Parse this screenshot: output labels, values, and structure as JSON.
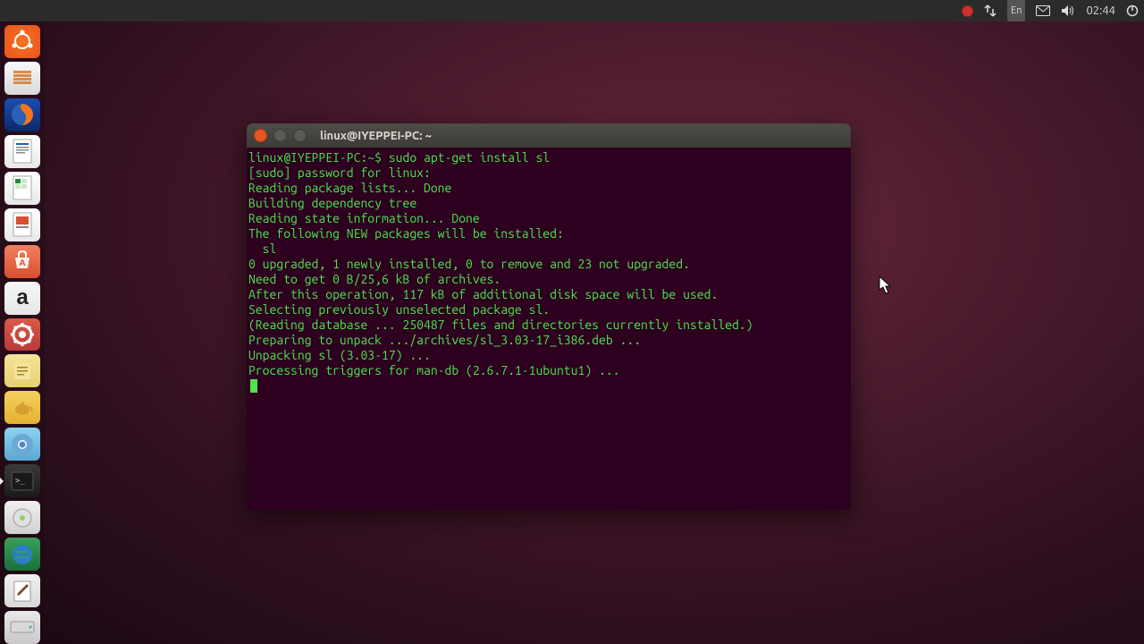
{
  "panel": {
    "language": "En",
    "clock": "02:44"
  },
  "launcher": {
    "items": [
      {
        "name": "dash",
        "label": "Ubuntu Dash"
      },
      {
        "name": "files",
        "label": "Files"
      },
      {
        "name": "firefox",
        "label": "Firefox"
      },
      {
        "name": "writer",
        "label": "LibreOffice Writer"
      },
      {
        "name": "calc",
        "label": "LibreOffice Calc"
      },
      {
        "name": "impress",
        "label": "LibreOffice Impress"
      },
      {
        "name": "software-center",
        "label": "Ubuntu Software Center"
      },
      {
        "name": "amazon",
        "label": "Amazon"
      },
      {
        "name": "system-settings",
        "label": "System Settings"
      },
      {
        "name": "notes",
        "label": "Notes"
      },
      {
        "name": "teapot",
        "label": "Teapot"
      },
      {
        "name": "chromium",
        "label": "Chromium"
      },
      {
        "name": "terminal",
        "label": "Terminal"
      },
      {
        "name": "disks",
        "label": "Disks"
      },
      {
        "name": "web",
        "label": "Web"
      },
      {
        "name": "text-editor",
        "label": "Text Editor"
      },
      {
        "name": "drive",
        "label": "Removable Drive"
      }
    ],
    "amazon_letter": "a"
  },
  "terminal": {
    "title": "linux@IYEPPEI-PC: ~",
    "lines": [
      "linux@IYEPPEI-PC:~$ sudo apt-get install sl",
      "[sudo] password for linux: ",
      "Reading package lists... Done",
      "Building dependency tree       ",
      "Reading state information... Done",
      "The following NEW packages will be installed:",
      "  sl",
      "0 upgraded, 1 newly installed, 0 to remove and 23 not upgraded.",
      "Need to get 0 B/25,6 kB of archives.",
      "After this operation, 117 kB of additional disk space will be used.",
      "Selecting previously unselected package sl.",
      "(Reading database ... 250487 files and directories currently installed.)",
      "Preparing to unpack .../archives/sl_3.03-17_i386.deb ...",
      "Unpacking sl (3.03-17) ...",
      "Processing triggers for man-db (2.6.7.1-1ubuntu1) ..."
    ]
  }
}
